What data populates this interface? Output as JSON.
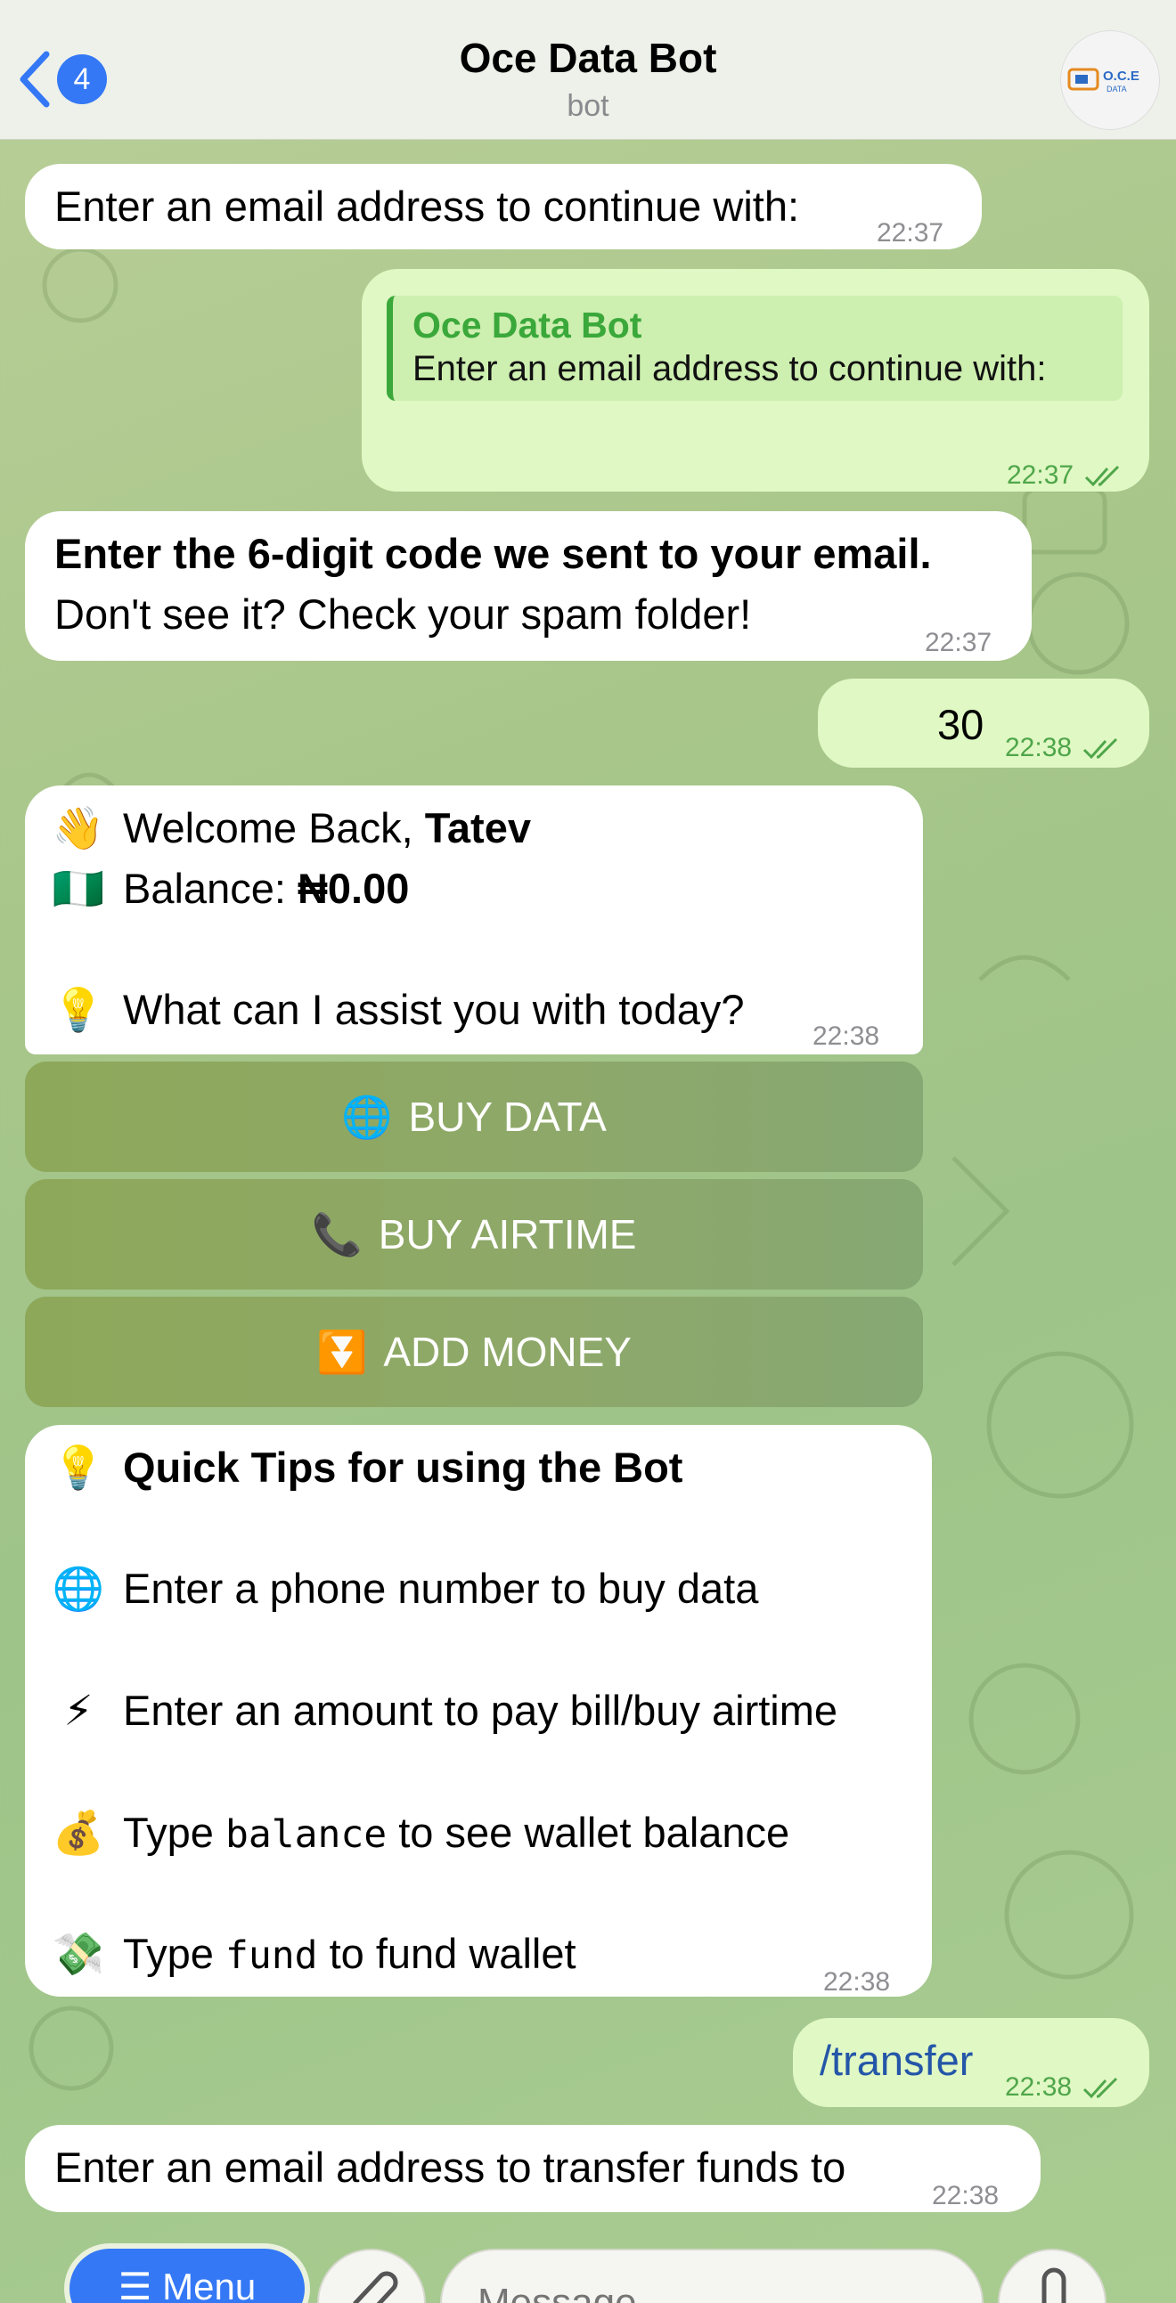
{
  "header": {
    "back_count": "4",
    "title": "Oce Data Bot",
    "subtitle": "bot",
    "avatar_label": "O.C.E",
    "avatar_sub": "DATA"
  },
  "messages": {
    "m1": {
      "text": "Enter an email address to continue with:",
      "time": "22:37"
    },
    "m2": {
      "quote_name": "Oce Data Bot",
      "quote_text": "Enter an email address to continue with:",
      "time": "22:37"
    },
    "m3": {
      "bold": "Enter the 6-digit code we sent to your email.",
      "text": "Don't see it? Check your spam folder!",
      "time": "22:37"
    },
    "m4": {
      "text": "30",
      "time": "22:38"
    },
    "m5": {
      "welcome_prefix": "Welcome Back, ",
      "name": "Tatev",
      "balance_prefix": "Balance: ",
      "balance": "₦0.00",
      "question": "What can I assist you with today?",
      "time": "22:38",
      "icons": {
        "wave": "👋",
        "flag": "🇳🇬",
        "bulb": "💡"
      }
    },
    "buttons": [
      {
        "icon": "🌐",
        "label": "BUY DATA"
      },
      {
        "icon": "📞",
        "label": "BUY AIRTIME"
      },
      {
        "icon": "⏬",
        "label": "ADD MONEY"
      }
    ],
    "m6": {
      "heading": "Quick Tips for using the Bot",
      "tip1": "Enter a phone number to buy data",
      "tip2": "Enter an amount to pay bill/buy airtime",
      "tip3_pre": "Type ",
      "tip3_code": "balance",
      "tip3_post": " to see wallet balance",
      "tip4_pre": "Type ",
      "tip4_code": "fund",
      "tip4_post": " to fund wallet",
      "time": "22:38",
      "icons": {
        "bulb": "💡",
        "globe": "🌐",
        "bolt": "⚡",
        "bag": "💰",
        "money": "💸"
      }
    },
    "m7": {
      "text": "/transfer",
      "time": "22:38"
    },
    "m8": {
      "text": "Enter an email address to transfer funds to",
      "time": "22:38"
    }
  },
  "composer": {
    "menu_label": "☰ Menu",
    "placeholder": "Message"
  },
  "colors": {
    "accent": "#3478f6",
    "outgoing_bubble": "#e0f8c4",
    "incoming_bubble": "#ffffff",
    "check_green": "#4fa64a",
    "keyboard_button": "#8ea85a"
  }
}
